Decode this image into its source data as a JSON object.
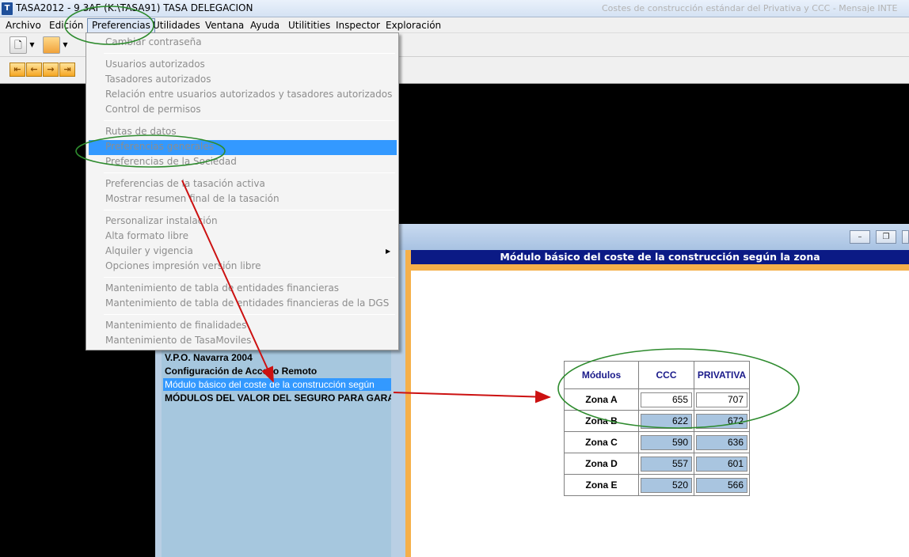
{
  "window": {
    "title": "TASA2012 - 9.3AF (K:\\TASA91)  TASA DELEGACION",
    "title_right": "Costes de construcción estándar del Privativa y CCC  - Mensaje INTE",
    "app_icon_text": "T"
  },
  "menubar": {
    "items": [
      "Archivo",
      "Edición",
      "Preferencias",
      "Utilidades",
      "Ventana",
      "Ayuda",
      "Utilitities",
      "Inspector",
      "Exploración"
    ]
  },
  "dropdown": {
    "items": [
      "Cambiar contraseña",
      "Usuarios autorizados",
      "Tasadores autorizados",
      "Relación entre usuarios autorizados y tasadores autorizados",
      "Control de permisos",
      "Rutas de datos",
      "Preferencias generales",
      "Preferencias de la Sociedad",
      "Preferencias de la tasación activa",
      "Mostrar resumen final de la tasación",
      "Personalizar instalación",
      "Alta formato libre",
      "Alquiler y vigencia",
      "Opciones impresión versión libre",
      "Mantenimiento de tabla de entidades financieras",
      "Mantenimiento de tabla de entidades financieras de la DGS",
      "Mantenimiento de finalidades",
      "Mantenimiento de TasaMoviles"
    ],
    "highlighted": "Preferencias generales",
    "submenu_item": "Alquiler y vigencia"
  },
  "left_list": {
    "items": [
      "V.P.O. Navarra 2004",
      "Configuración de Acceso Remoto",
      "Módulo básico del coste de la construcción según",
      "MÓDULOS DEL VALOR DEL SEGURO PARA GARAJE"
    ],
    "selected": "Módulo básico del coste de la construcción según"
  },
  "content": {
    "header": "Módulo básico del coste de la construcción según la zona"
  },
  "table": {
    "headers": [
      "Módulos",
      "CCC",
      "PRIVATIVA"
    ],
    "rows": [
      {
        "zona": "Zona A",
        "ccc": "655",
        "privativa": "707"
      },
      {
        "zona": "Zona B",
        "ccc": "622",
        "privativa": "672"
      },
      {
        "zona": "Zona C",
        "ccc": "590",
        "privativa": "636"
      },
      {
        "zona": "Zona D",
        "ccc": "557",
        "privativa": "601"
      },
      {
        "zona": "Zona E",
        "ccc": "520",
        "privativa": "566"
      }
    ]
  },
  "window_buttons": [
    "minimize",
    "restore",
    "close"
  ],
  "colors": {
    "header_bg": "#0b1a85",
    "highlight": "#3399ff",
    "annotation_green": "#2e8b2e",
    "annotation_red": "#cc1111",
    "frame_orange": "#f5b04a",
    "cell_blue": "#a9c5e0"
  }
}
